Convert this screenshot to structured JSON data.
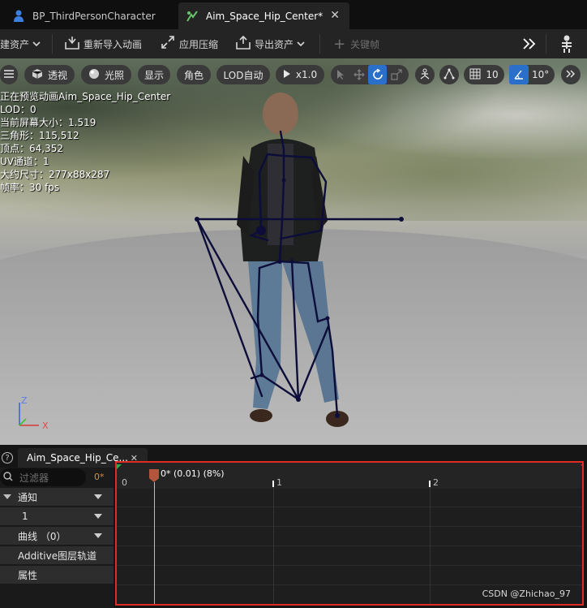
{
  "tabs": [
    {
      "label": "BP_ThirdPersonCharacter",
      "icon": "character-blueprint-icon"
    },
    {
      "label": "Aim_Space_Hip_Center*",
      "icon": "animation-sequence-icon",
      "close": "✕"
    }
  ],
  "toolbar": {
    "create_asset": "创建资产",
    "reimport": "重新导入动画",
    "apply_compression": "应用压缩",
    "export_asset": "导出资产",
    "keyframe": "关键帧"
  },
  "viewport": {
    "menu_icon": "hamburger-menu-icon",
    "perspective": "透视",
    "lit": "光照",
    "show": "显示",
    "character": "角色",
    "lod": "LOD自动",
    "play_speed": "x1.0",
    "grid_size": "10",
    "rotation_snap": "10°",
    "stats": [
      "正在预览动画Aim_Space_Hip_Center",
      "LOD：0",
      "当前屏幕大小：1.519",
      "三角形：115,512",
      "顶点：64,352",
      "UV通道：1",
      "大约尺寸：277x88x287",
      "帧率：30 fps"
    ],
    "axis_labels": {
      "z": "Z",
      "x": "X"
    }
  },
  "anim_panel": {
    "tab_label": "Aim_Space_Hip_Ce...",
    "tab_close": "✕",
    "help": "?",
    "filter_placeholder": "过滤器",
    "frame_indicator": "0*",
    "rows": [
      {
        "label": "通知",
        "has_dropdown": true
      },
      {
        "label": "1",
        "has_dropdown": true
      },
      {
        "label": "曲线 （0）",
        "has_dropdown": true
      },
      {
        "label": "Additive图层轨道",
        "has_dropdown": false
      },
      {
        "label": "属性",
        "has_dropdown": false
      }
    ],
    "playhead_label": "0* (0.01) (8%)",
    "ruler_ticks": [
      "0",
      "1",
      "2"
    ]
  },
  "watermark": "CSDN @Zhichao_97",
  "colors": {
    "accent_blue": "#2a6fc9",
    "highlight_border": "#e02c23",
    "playhead": "#b4553d",
    "bone": "#0d0d3a"
  }
}
